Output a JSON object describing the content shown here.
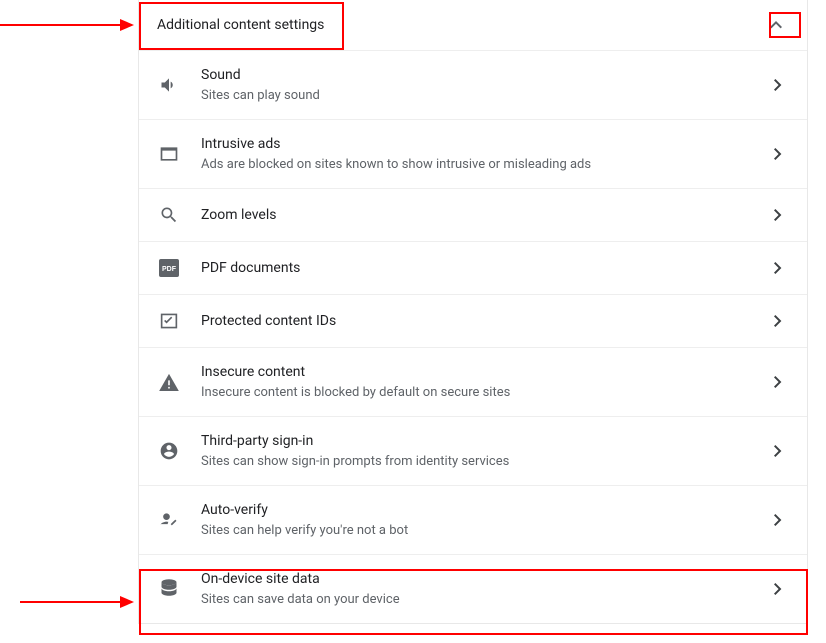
{
  "header": {
    "title": "Additional content settings"
  },
  "items": [
    {
      "title": "Sound",
      "sub": "Sites can play sound"
    },
    {
      "title": "Intrusive ads",
      "sub": "Ads are blocked on sites known to show intrusive or misleading ads"
    },
    {
      "title": "Zoom levels",
      "sub": ""
    },
    {
      "title": "PDF documents",
      "sub": ""
    },
    {
      "title": "Protected content IDs",
      "sub": ""
    },
    {
      "title": "Insecure content",
      "sub": "Insecure content is blocked by default on secure sites"
    },
    {
      "title": "Third-party sign-in",
      "sub": "Sites can show sign-in prompts from identity services"
    },
    {
      "title": "Auto-verify",
      "sub": "Sites can help verify you're not a bot"
    },
    {
      "title": "On-device site data",
      "sub": "Sites can save data on your device"
    }
  ]
}
